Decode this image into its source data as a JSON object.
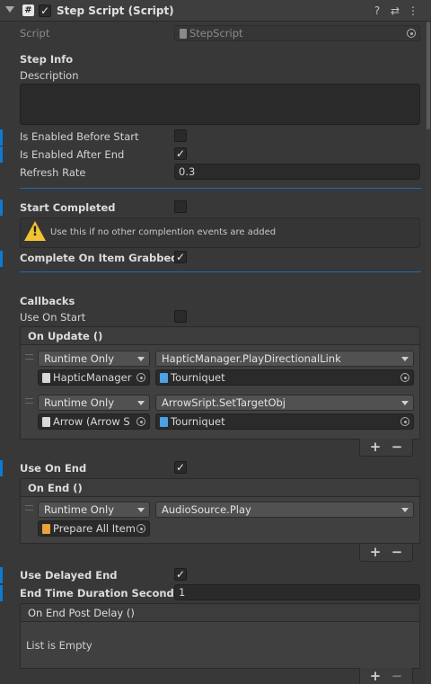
{
  "header": {
    "title": "Step Script (Script)",
    "enabled": true
  },
  "script": {
    "label": "Script",
    "value": "StepScript"
  },
  "step_info": {
    "heading": "Step Info",
    "description_label": "Description",
    "description_value": ""
  },
  "fields": {
    "enabled_before_start": {
      "label": "Is Enabled Before Start",
      "checked": false
    },
    "enabled_after_end": {
      "label": "Is Enabled After End",
      "checked": true
    },
    "refresh_rate": {
      "label": "Refresh Rate",
      "value": "0.3"
    },
    "start_completed": {
      "label": "Start Completed",
      "checked": false
    },
    "complete_on_grab": {
      "label": "Complete On Item Grabbed",
      "checked": true
    },
    "use_on_start": {
      "label": "Use On Start",
      "checked": false
    },
    "use_on_end": {
      "label": "Use On End",
      "checked": true
    },
    "use_delayed_end": {
      "label": "Use Delayed End",
      "checked": true
    },
    "end_time_duration": {
      "label": "End Time Duration Seconds",
      "value": "1"
    }
  },
  "help_box": {
    "message": "Use this if no other complention events are added"
  },
  "callbacks": {
    "heading": "Callbacks"
  },
  "on_update": {
    "title": "On Update ()",
    "entries": [
      {
        "mode": "Runtime Only",
        "function": "HapticManager.PlayDirectionalLink",
        "object": "HapticManager",
        "argument": "Tourniquet"
      },
      {
        "mode": "Runtime Only",
        "function": "ArrowSript.SetTargetObj",
        "object": "Arrow (Arrow S",
        "argument": "Tourniquet"
      }
    ]
  },
  "on_end": {
    "title": "On End ()",
    "entries": [
      {
        "mode": "Runtime Only",
        "function": "AudioSource.Play",
        "object": "Prepare All Item"
      }
    ]
  },
  "on_end_post_delay": {
    "title": "On End Post Delay ()",
    "empty_text": "List is Empty"
  },
  "list_controls": {
    "add": "+",
    "remove": "−"
  },
  "colors": {
    "accent": "#0e7ad1",
    "warning": "#f2c230",
    "background": "#383838"
  }
}
